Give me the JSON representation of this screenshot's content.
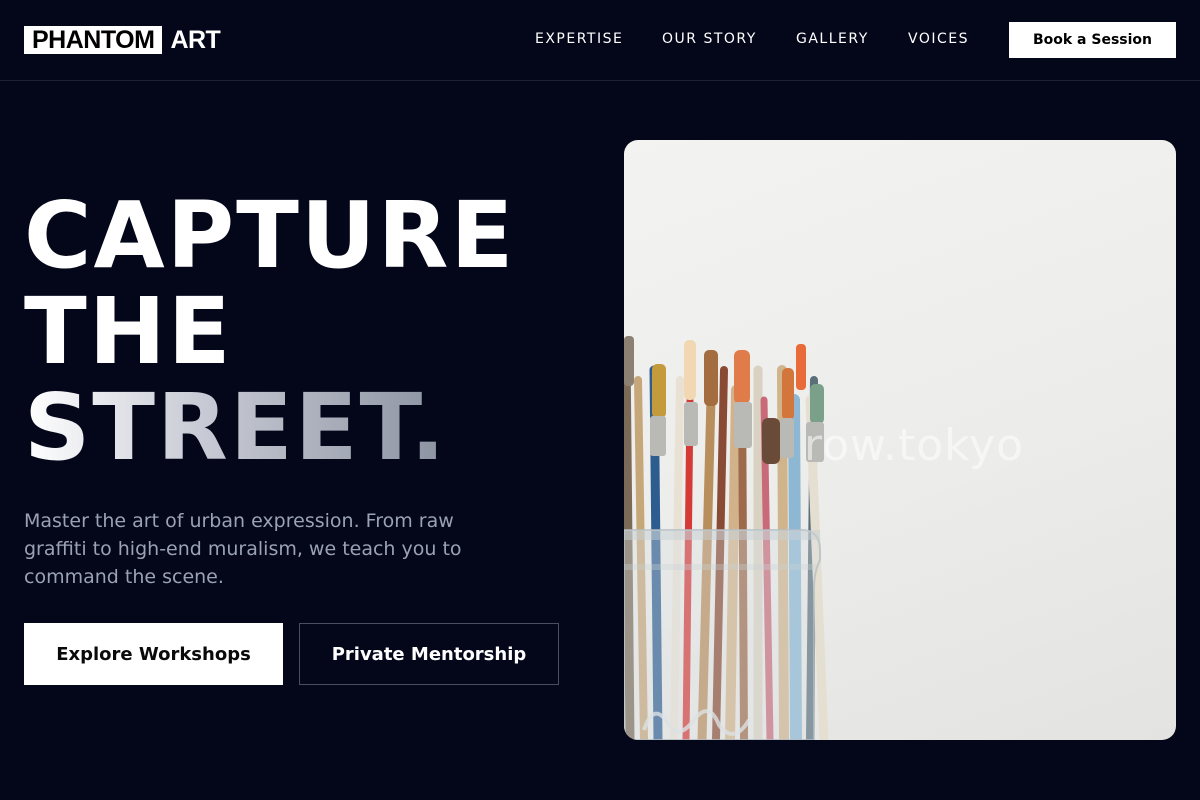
{
  "brand": {
    "logo_box": "PHANTOM",
    "logo_rest": "ART"
  },
  "nav": {
    "items": [
      {
        "label": "EXPERTISE"
      },
      {
        "label": "OUR STORY"
      },
      {
        "label": "GALLERY"
      },
      {
        "label": "VOICES"
      }
    ],
    "cta_label": "Book a Session"
  },
  "hero": {
    "headline_line1": "CAPTURE",
    "headline_line2": "THE",
    "headline_line3": "STREET.",
    "subtext": "Master the art of urban expression. From raw graffiti to high-end muralism, we teach you to command the scene.",
    "primary_button": "Explore Workshops",
    "secondary_button": "Private Mentorship",
    "image_watermark": "row.tokyo"
  },
  "colors": {
    "background": "#04061a",
    "text_primary": "#ffffff",
    "text_muted": "#9aa2b3",
    "button_bg": "#ffffff"
  }
}
